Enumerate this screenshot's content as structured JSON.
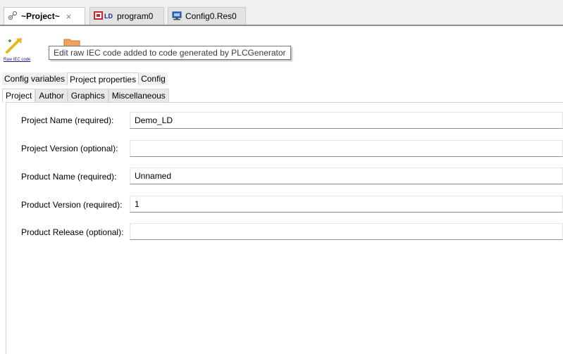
{
  "editor_tabs": [
    {
      "label": "~Project~",
      "close": "×"
    },
    {
      "label": "program0"
    },
    {
      "label": "Config0.Res0"
    }
  ],
  "toolbar": {
    "raw_iec_label": "Raw IEC code",
    "tooltip": "Edit raw IEC code added to code generated by PLCGenerator"
  },
  "main_tabs": [
    "Config variables",
    "Project properties",
    "Config"
  ],
  "sub_tabs": [
    "Project",
    "Author",
    "Graphics",
    "Miscellaneous"
  ],
  "form": {
    "project_name_label": "Project Name (required):",
    "project_name_value": "Demo_LD",
    "project_version_label": "Project Version (optional):",
    "project_version_value": "",
    "product_name_label": "Product Name (required):",
    "product_name_value": "Unnamed",
    "product_version_label": "Product Version (required):",
    "product_version_value": "1",
    "product_release_label": "Product Release (optional):",
    "product_release_value": ""
  }
}
